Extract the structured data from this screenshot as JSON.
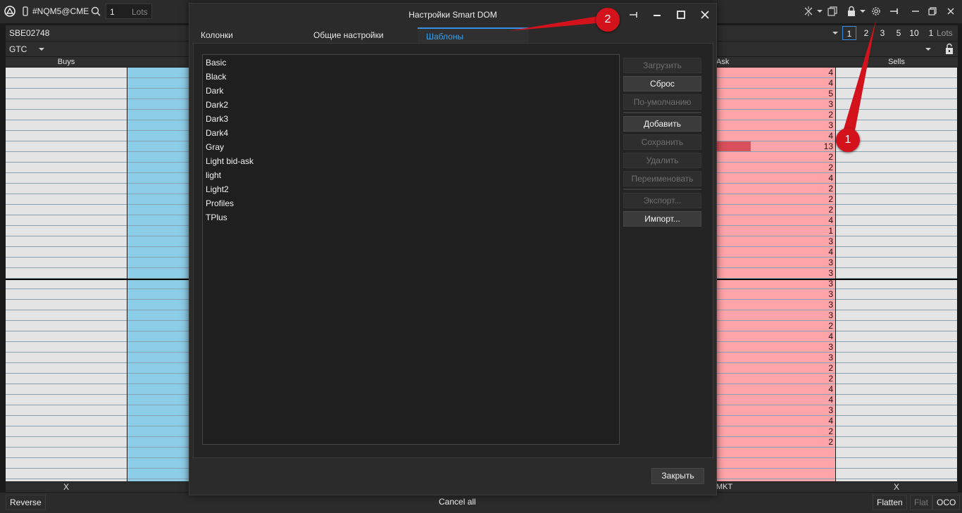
{
  "toolbar": {
    "symbol": "#NQM5@CME",
    "quantity": "1",
    "qty_unit": "Lots"
  },
  "account": "SBE02748",
  "tif": "GTC",
  "levels": [
    "1",
    "2",
    "3",
    "5",
    "10",
    "1",
    "Lots"
  ],
  "columns": {
    "buys": "Buys",
    "ask": "Ask",
    "sells": "Sells"
  },
  "ask_values": [
    "4",
    "4",
    "5",
    "3",
    "2",
    "3",
    "4",
    "13",
    "2",
    "2",
    "4",
    "2",
    "2",
    "2",
    "4",
    "1",
    "3",
    "4",
    "3",
    "3",
    "3",
    "3",
    "3",
    "3",
    "2",
    "4",
    "3",
    "3",
    "2",
    "2",
    "4",
    "4",
    "3",
    "4",
    "2",
    "2"
  ],
  "ask_highlight_fraction": 0.29,
  "footer_row": {
    "buys": "X",
    "ask": "MKT",
    "sells": "X"
  },
  "bottom": {
    "reverse": "Reverse",
    "cancel_all": "Cancel all",
    "flatten": "Flatten",
    "flat": "Flat",
    "oco": "OCO"
  },
  "dialog": {
    "title": "Настройки Smart DOM",
    "tabs": [
      "Колонки",
      "Общие настройки",
      "Шаблоны"
    ],
    "templates": [
      "Basic",
      "Black",
      "Dark",
      "Dark2",
      "Dark3",
      "Dark4",
      "Gray",
      "Light bid-ask",
      "light",
      "Light2",
      "Profiles",
      "TPlus"
    ],
    "buttons": {
      "load": "Загрузить",
      "reset": "Сброс",
      "default": "По-умолчанию",
      "add": "Добавить",
      "save": "Сохранить",
      "delete": "Удалить",
      "rename": "Переименовать",
      "export": "Экспорт...",
      "import": "Импорт..."
    },
    "close": "Закрыть"
  },
  "callouts": [
    "1",
    "2"
  ],
  "colors": {
    "accent": "#3a8ee0",
    "ask_bg": "#ffa4a8",
    "bid_bg": "#8ccde8",
    "callout": "#d3121c"
  }
}
